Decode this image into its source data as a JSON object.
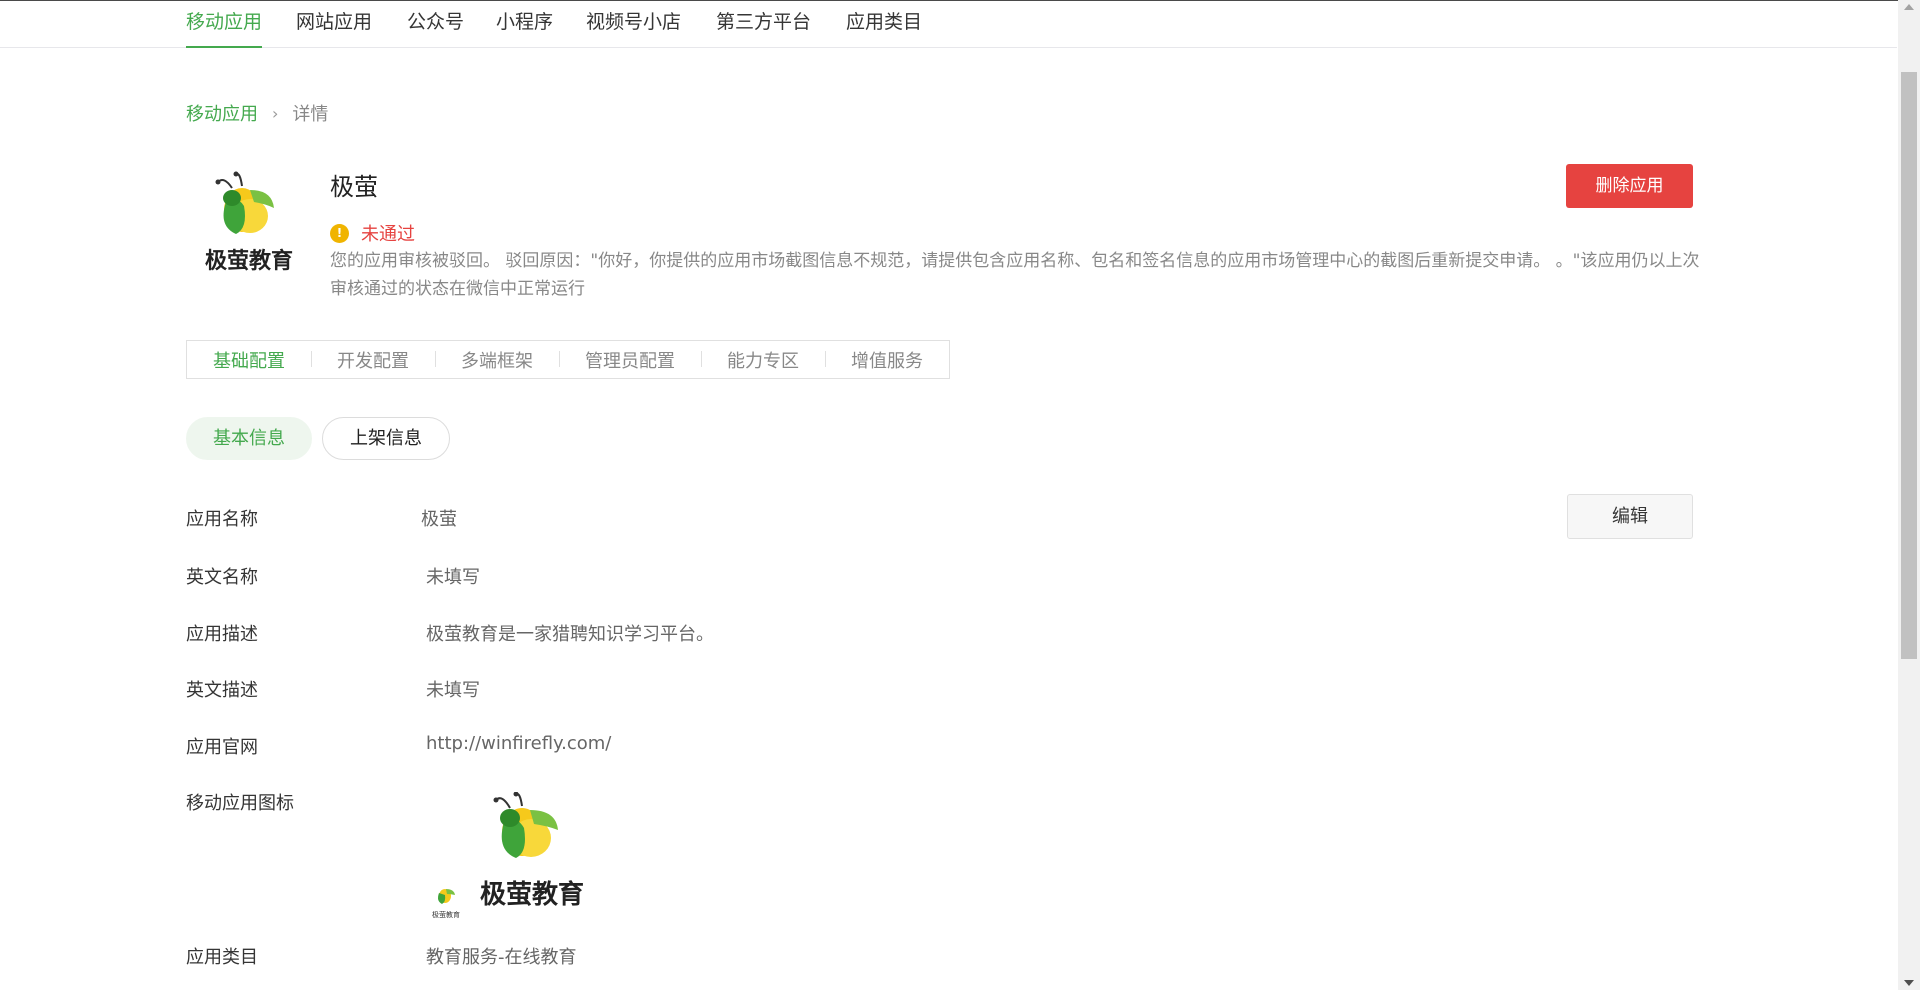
{
  "topnav": {
    "tabs": [
      {
        "label": "移动应用",
        "active": true
      },
      {
        "label": "网站应用"
      },
      {
        "label": "公众号"
      },
      {
        "label": "小程序"
      },
      {
        "label": "视频号小店"
      },
      {
        "label": "第三方平台"
      },
      {
        "label": "应用类目"
      }
    ]
  },
  "breadcrumb": {
    "parent": "移动应用",
    "current": "详情"
  },
  "app": {
    "name": "极萤",
    "logo_text": "极萤教育",
    "status": "未通过",
    "reject_message": "您的应用审核被驳回。 驳回原因：\"你好，你提供的应用市场截图信息不规范，请提供包含应用名称、包名和签名信息的应用市场管理中心的截图后重新提交申请。 。\"该应用仍以上次审核通过的状态在微信中正常运行",
    "delete_label": "删除应用"
  },
  "subtabs": [
    "基础配置",
    "开发配置",
    "多端框架",
    "管理员配置",
    "能力专区",
    "增值服务"
  ],
  "info_tabs": {
    "basic": "基本信息",
    "listing": "上架信息"
  },
  "edit_label": "编辑",
  "fields": {
    "app_name": {
      "label": "应用名称",
      "value": "极萤"
    },
    "en_name": {
      "label": "英文名称",
      "value": "未填写"
    },
    "desc": {
      "label": "应用描述",
      "value": "极萤教育是一家猎聘知识学习平台。"
    },
    "en_desc": {
      "label": "英文描述",
      "value": "未填写"
    },
    "website": {
      "label": "应用官网",
      "value": "http://winfirefly.com/"
    },
    "icon": {
      "label": "移动应用图标"
    },
    "category": {
      "label": "应用类目",
      "value": "教育服务-在线教育"
    }
  },
  "colors": {
    "accent": "#44a94e",
    "danger": "#e64340",
    "warning": "#f0b400"
  }
}
